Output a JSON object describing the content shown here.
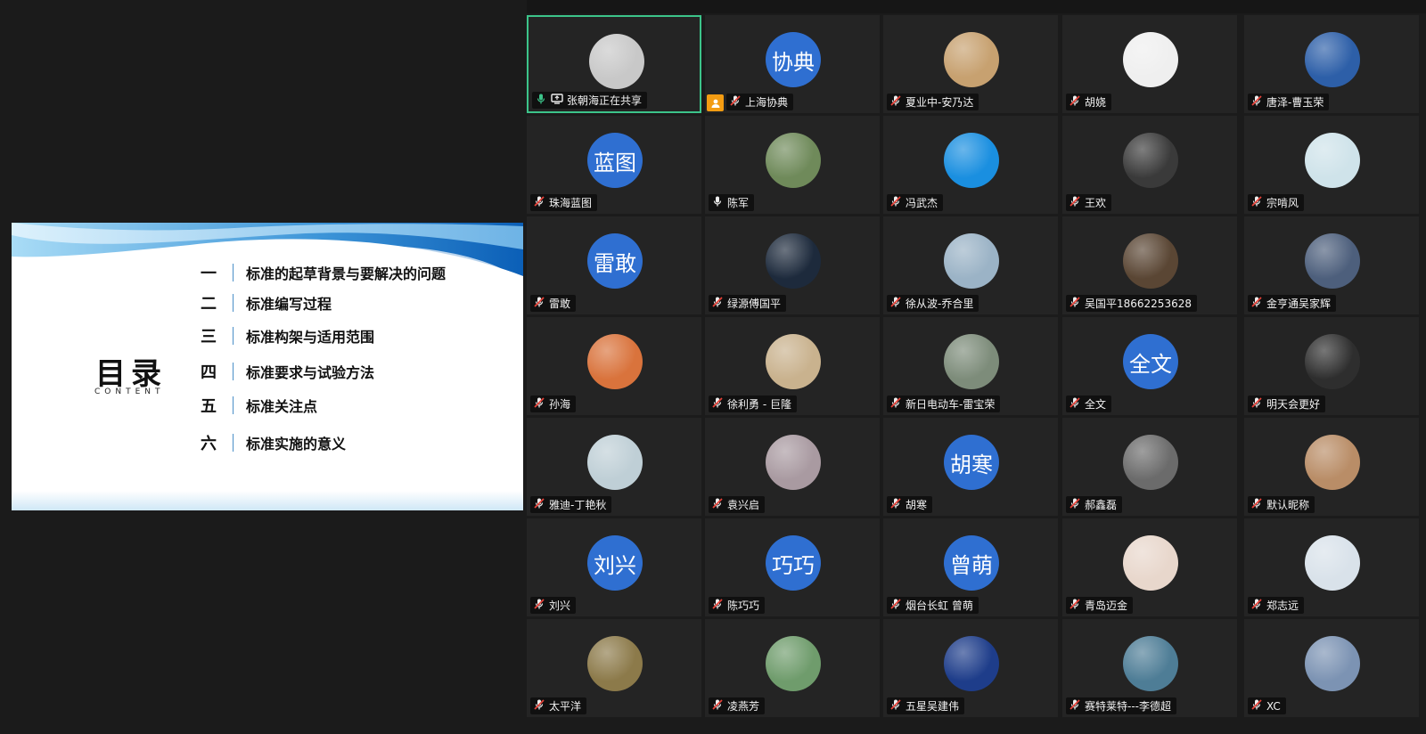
{
  "slide": {
    "title": "目录",
    "subtitle": "CONTENT",
    "items": [
      {
        "num": "一",
        "text": "标准的起草背景与要解决的问题"
      },
      {
        "num": "二",
        "text": "标准编写过程"
      },
      {
        "num": "三",
        "text": "标准构架与适用范围"
      },
      {
        "num": "四",
        "text": "标准要求与试验方法"
      },
      {
        "num": "五",
        "text": "标准关注点"
      },
      {
        "num": "六",
        "text": "标准实施的意义"
      }
    ]
  },
  "colors": {
    "accent_active": "#3cc48a",
    "avatar_blue": "#2f6fd1",
    "host_badge": "#f39c12"
  },
  "participants": [
    {
      "name": "张朝海正在共享",
      "mic": "sharing",
      "avatar": "photo",
      "color": "#c8c8c8",
      "active": true
    },
    {
      "name": "上海协典",
      "mic": "muted",
      "avatar": "text",
      "label": "协典",
      "badge": true
    },
    {
      "name": "夏业中-安乃达",
      "mic": "muted",
      "avatar": "photo",
      "color": "#c7a170"
    },
    {
      "name": "胡娆",
      "mic": "muted",
      "avatar": "photo",
      "color": "#efefef"
    },
    {
      "name": "唐泽-曹玉荣",
      "mic": "muted",
      "avatar": "photo",
      "color": "#2d5fa8"
    },
    {
      "name": "珠海蓝图",
      "mic": "muted",
      "avatar": "text",
      "label": "蓝图"
    },
    {
      "name": "陈军",
      "mic": "on",
      "avatar": "photo",
      "color": "#6f8a5a"
    },
    {
      "name": "冯武杰",
      "mic": "muted",
      "avatar": "photo",
      "color": "#1a8fe0"
    },
    {
      "name": "王欢",
      "mic": "muted",
      "avatar": "photo",
      "color": "#3a3a3a"
    },
    {
      "name": "宗啃风",
      "mic": "muted",
      "avatar": "photo",
      "color": "#cfe3ea"
    },
    {
      "name": "雷敢",
      "mic": "muted",
      "avatar": "text",
      "label": "雷敢"
    },
    {
      "name": "绿源傅国平",
      "mic": "muted",
      "avatar": "photo",
      "color": "#1d2a3c"
    },
    {
      "name": "徐从波-乔合里",
      "mic": "muted",
      "avatar": "photo",
      "color": "#9bb3c6"
    },
    {
      "name": "吴国平18662253628",
      "mic": "muted",
      "avatar": "photo",
      "color": "#5a4634"
    },
    {
      "name": "金亨通吴家辉",
      "mic": "muted",
      "avatar": "photo",
      "color": "#4d5f7c"
    },
    {
      "name": "孙海",
      "mic": "muted",
      "avatar": "photo",
      "color": "#d9733c"
    },
    {
      "name": "徐利勇 - 巨隆",
      "mic": "muted",
      "avatar": "photo",
      "color": "#c9b28e"
    },
    {
      "name": "新日电动车-雷宝荣",
      "mic": "muted",
      "avatar": "photo",
      "color": "#7d8c7a"
    },
    {
      "name": "全文",
      "mic": "muted",
      "avatar": "text",
      "label": "全文"
    },
    {
      "name": "明天会更好",
      "mic": "muted",
      "avatar": "photo",
      "color": "#2e2e2e"
    },
    {
      "name": "雅迪-丁艳秋",
      "mic": "muted",
      "avatar": "photo",
      "color": "#bfcfd6"
    },
    {
      "name": "袁兴启",
      "mic": "muted",
      "avatar": "photo",
      "color": "#a99aa1"
    },
    {
      "name": "胡寒",
      "mic": "muted",
      "avatar": "text",
      "label": "胡寒"
    },
    {
      "name": "郝鑫磊",
      "mic": "muted",
      "avatar": "photo",
      "color": "#6b6b6b"
    },
    {
      "name": "默认昵称",
      "mic": "muted",
      "avatar": "photo",
      "color": "#b98d67"
    },
    {
      "name": "刘兴",
      "mic": "muted",
      "avatar": "text",
      "label": "刘兴"
    },
    {
      "name": "陈巧巧",
      "mic": "muted",
      "avatar": "text",
      "label": "巧巧"
    },
    {
      "name": "烟台长虹 曾萌",
      "mic": "muted",
      "avatar": "text",
      "label": "曾萌"
    },
    {
      "name": "青岛迈金",
      "mic": "muted",
      "avatar": "photo",
      "color": "#e8d7cc"
    },
    {
      "name": "郑志远",
      "mic": "muted",
      "avatar": "photo",
      "color": "#d9e2ea"
    },
    {
      "name": "太平洋",
      "mic": "muted",
      "avatar": "photo",
      "color": "#8c7a4a"
    },
    {
      "name": "凌燕芳",
      "mic": "muted",
      "avatar": "photo",
      "color": "#6f9c6c"
    },
    {
      "name": "五星吴建伟",
      "mic": "muted",
      "avatar": "photo",
      "color": "#1e3d8a"
    },
    {
      "name": "赛特莱特---李德超",
      "mic": "muted",
      "avatar": "photo",
      "color": "#4e7d96"
    },
    {
      "name": "XC",
      "mic": "muted",
      "avatar": "photo",
      "color": "#7c93b3"
    }
  ]
}
